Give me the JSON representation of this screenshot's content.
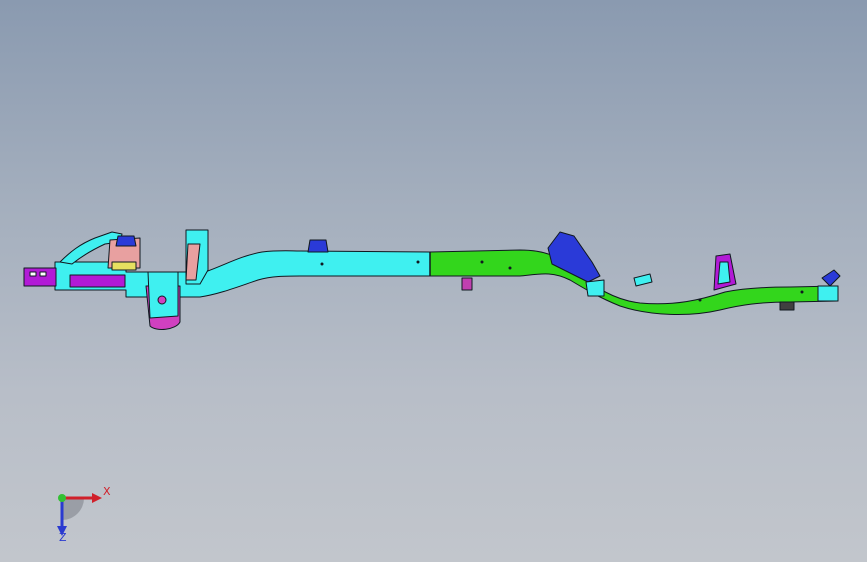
{
  "viewport": {
    "background_top": "#8a9ab0",
    "background_bottom": "#c2c6cc"
  },
  "model": {
    "name": "vehicle-frame-chassis",
    "colors": {
      "front_section": "#3ff0f0",
      "rear_section": "#33d61c",
      "outline": "#101820",
      "rail_end": "#b21ad6",
      "mount_pink": "#e8a0a0",
      "mount_yellow": "#e6e060",
      "bracket_blue": "#2a3ad8",
      "pad_magenta": "#d040c0"
    }
  },
  "triad": {
    "x_label": "X",
    "z_label": "Z",
    "x_color": "#d0202a",
    "z_color": "#2a3ad0",
    "origin_color": "#33c033",
    "icon": "coordinate-triad-icon"
  }
}
